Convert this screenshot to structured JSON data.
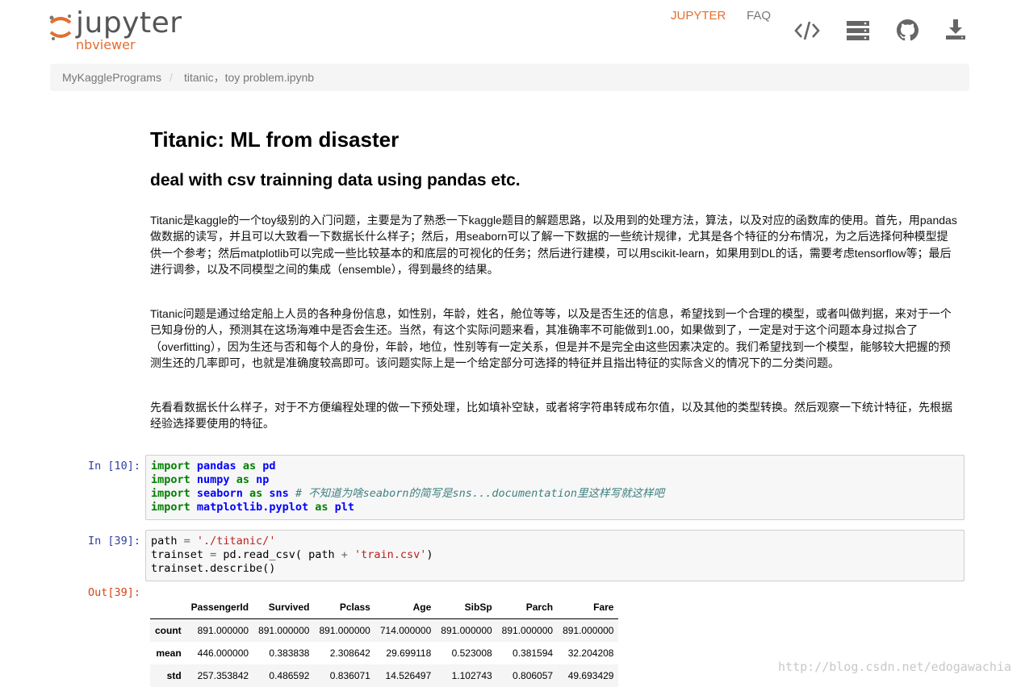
{
  "header": {
    "logo_title": "jupyter",
    "logo_subtitle": "nbviewer",
    "nav": {
      "jupyter_label": "JUPYTER",
      "faq_label": "FAQ",
      "code_icon": "code-icon",
      "server_icon": "server-icon",
      "github_icon": "github-icon",
      "download_icon": "download-icon"
    },
    "accent_color": "#e46e2e"
  },
  "breadcrumb": {
    "items": [
      "MyKagglePrograms",
      "titanic，toy problem.ipynb"
    ],
    "separator": "/"
  },
  "notebook": {
    "title": "Titanic: ML from disaster",
    "subtitle": "deal with csv trainning data using pandas etc.",
    "paragraphs": [
      "Titanic是kaggle的一个toy级别的入门问题，主要是为了熟悉一下kaggle题目的解题思路，以及用到的处理方法，算法，以及对应的函数库的使用。首先，用pandas做数据的读写，并且可以大致看一下数据长什么样子；然后，用seaborn可以了解一下数据的一些统计规律，尤其是各个特征的分布情况，为之后选择何种模型提供一个参考；然后matplotlib可以完成一些比较基本的和底层的可视化的任务；然后进行建模，可以用scikit-learn，如果用到DL的话，需要考虑tensorflow等；最后进行调参，以及不同模型之间的集成（ensemble），得到最终的结果。",
      "Titanic问题是通过给定船上人员的各种身份信息，如性别，年龄，姓名，舱位等等，以及是否生还的信息，希望找到一个合理的模型，或者叫做判据，来对于一个已知身份的人，预测其在这场海难中是否会生还。当然，有这个实际问题来看，其准确率不可能做到1.00，如果做到了，一定是对于这个问题本身过拟合了（overfitting），因为生还与否和每个人的身份，年龄，地位，性别等有一定关系，但是并不是完全由这些因素决定的。我们希望找到一个模型，能够较大把握的预测生还的几率即可，也就是准确度较高即可。该问题实际上是一个给定部分可选择的特征并且指出特征的实际含义的情况下的二分类问题。",
      "先看看数据长什么样子，对于不方便编程处理的做一下预处理，比如填补空缺，或者将字符串转成布尔值，以及其他的类型转换。然后观察一下统计特征，先根据经验选择要使用的特征。"
    ],
    "cells": [
      {
        "prompt": "In [10]:",
        "lines": [
          {
            "kw": "import",
            "mod": "pandas",
            "as": "as",
            "alias": "pd",
            "comment": ""
          },
          {
            "kw": "import",
            "mod": "numpy",
            "as": "as",
            "alias": "np",
            "comment": ""
          },
          {
            "kw": "import",
            "mod": "seaborn",
            "as": "as",
            "alias": "sns",
            "comment": "# 不知道为啥seaborn的简写是sns...documentation里这样写就这样吧"
          },
          {
            "kw": "import",
            "mod": "matplotlib.pyplot",
            "as": "as",
            "alias": "plt",
            "comment": ""
          }
        ]
      },
      {
        "prompt": "In [39]:",
        "line1_a": "path ",
        "line1_op": "=",
        "line1_str": " './titanic/'",
        "line2_a": "trainset ",
        "line2_op": "=",
        "line2_b": " pd.read_csv( path ",
        "line2_op2": "+",
        "line2_str": " 'train.csv'",
        "line2_c": ")",
        "line3": "trainset.describe()"
      }
    ],
    "output_prompt": "Out[39]:",
    "dataframe": {
      "columns": [
        "",
        "PassengerId",
        "Survived",
        "Pclass",
        "Age",
        "SibSp",
        "Parch",
        "Fare"
      ],
      "rows": [
        {
          "index": "count",
          "values": [
            "891.000000",
            "891.000000",
            "891.000000",
            "714.000000",
            "891.000000",
            "891.000000",
            "891.000000"
          ]
        },
        {
          "index": "mean",
          "values": [
            "446.000000",
            "0.383838",
            "2.308642",
            "29.699118",
            "0.523008",
            "0.381594",
            "32.204208"
          ]
        },
        {
          "index": "std",
          "values": [
            "257.353842",
            "0.486592",
            "0.836071",
            "14.526497",
            "1.102743",
            "0.806057",
            "49.693429"
          ]
        }
      ]
    }
  },
  "watermark": "http://blog.csdn.net/edogawachia"
}
